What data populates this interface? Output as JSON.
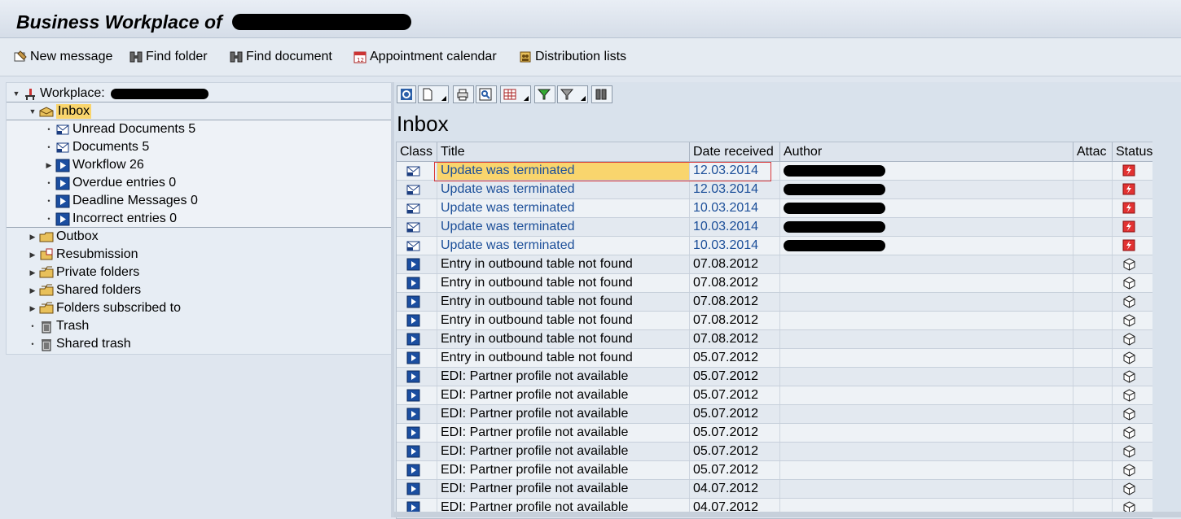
{
  "window": {
    "title": "Business Workplace of"
  },
  "app_toolbar": [
    {
      "label": "New message",
      "icon": "new-message-icon"
    },
    {
      "label": "Find folder",
      "icon": "binoculars-icon"
    },
    {
      "label": "Find document",
      "icon": "binoculars-icon"
    },
    {
      "label": "Appointment calendar",
      "icon": "calendar-icon"
    },
    {
      "label": "Distribution lists",
      "icon": "distribution-list-icon"
    }
  ],
  "tree": {
    "workplace_label": "Workplace:",
    "inbox_label": "Inbox",
    "inbox_children": [
      {
        "label": "Unread Documents 5",
        "icon": "document-icon"
      },
      {
        "label": "Documents 5",
        "icon": "document-icon"
      },
      {
        "label": "Workflow 26",
        "icon": "workflow-icon"
      },
      {
        "label": "Overdue entries 0",
        "icon": "workflow-icon"
      },
      {
        "label": "Deadline Messages 0",
        "icon": "workflow-icon"
      },
      {
        "label": "Incorrect entries 0",
        "icon": "workflow-icon"
      }
    ],
    "other_folders": [
      {
        "label": "Outbox",
        "icon": "folder-icon"
      },
      {
        "label": "Resubmission",
        "icon": "resubmission-icon"
      },
      {
        "label": "Private folders",
        "icon": "folder-stack-icon"
      },
      {
        "label": "Shared folders",
        "icon": "folder-stack-icon"
      },
      {
        "label": "Folders subscribed to",
        "icon": "folder-stack-icon"
      },
      {
        "label": "Trash",
        "icon": "trash-icon"
      },
      {
        "label": "Shared trash",
        "icon": "trash-icon"
      }
    ]
  },
  "inbox": {
    "heading": "Inbox",
    "columns": {
      "class": "Class",
      "title": "Title",
      "date": "Date received",
      "author": "Author",
      "attachment": "Attac",
      "status": "Status"
    },
    "rows": [
      {
        "type": "doc",
        "title": "Update was terminated",
        "date": "12.03.2014",
        "status": "error"
      },
      {
        "type": "doc",
        "title": "Update was terminated",
        "date": "12.03.2014",
        "status": "error"
      },
      {
        "type": "doc",
        "title": "Update was terminated",
        "date": "10.03.2014",
        "status": "error"
      },
      {
        "type": "doc",
        "title": "Update was terminated",
        "date": "10.03.2014",
        "status": "error"
      },
      {
        "type": "doc",
        "title": "Update was terminated",
        "date": "10.03.2014",
        "status": "error"
      },
      {
        "type": "wf",
        "title": "Entry in outbound table not found",
        "date": "07.08.2012",
        "status": "ready"
      },
      {
        "type": "wf",
        "title": "Entry in outbound table not found",
        "date": "07.08.2012",
        "status": "ready"
      },
      {
        "type": "wf",
        "title": "Entry in outbound table not found",
        "date": "07.08.2012",
        "status": "ready"
      },
      {
        "type": "wf",
        "title": "Entry in outbound table not found",
        "date": "07.08.2012",
        "status": "ready"
      },
      {
        "type": "wf",
        "title": "Entry in outbound table not found",
        "date": "07.08.2012",
        "status": "ready"
      },
      {
        "type": "wf",
        "title": "Entry in outbound table not found",
        "date": "05.07.2012",
        "status": "ready"
      },
      {
        "type": "wf",
        "title": "EDI: Partner profile not available",
        "date": "05.07.2012",
        "status": "ready"
      },
      {
        "type": "wf",
        "title": "EDI: Partner profile not available",
        "date": "05.07.2012",
        "status": "ready"
      },
      {
        "type": "wf",
        "title": "EDI: Partner profile not available",
        "date": "05.07.2012",
        "status": "ready"
      },
      {
        "type": "wf",
        "title": "EDI: Partner profile not available",
        "date": "05.07.2012",
        "status": "ready"
      },
      {
        "type": "wf",
        "title": "EDI: Partner profile not available",
        "date": "05.07.2012",
        "status": "ready"
      },
      {
        "type": "wf",
        "title": "EDI: Partner profile not available",
        "date": "05.07.2012",
        "status": "ready"
      },
      {
        "type": "wf",
        "title": "EDI: Partner profile not available",
        "date": "04.07.2012",
        "status": "ready"
      },
      {
        "type": "wf",
        "title": "EDI: Partner profile not available",
        "date": "04.07.2012",
        "status": "ready"
      }
    ]
  },
  "colors": {
    "selection": "#f9d56d",
    "link_blue": "#1c4f99",
    "error_red": "#e23232",
    "highlight_border": "#d9383a"
  }
}
